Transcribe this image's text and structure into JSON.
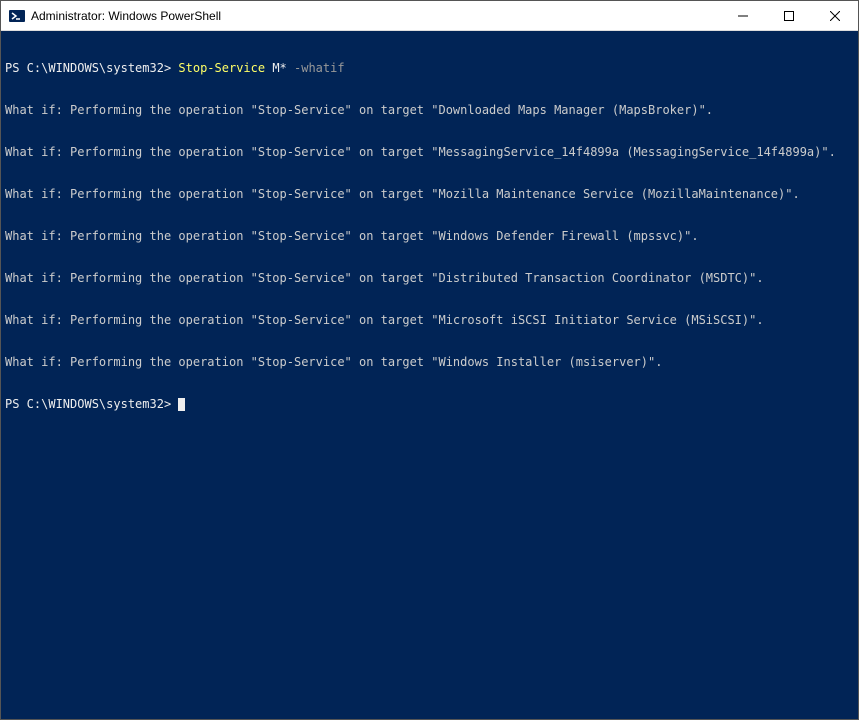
{
  "titlebar": {
    "title": "Administrator: Windows PowerShell"
  },
  "terminal": {
    "prompt1": "PS C:\\WINDOWS\\system32> ",
    "command": "Stop-Service",
    "arg": " M* ",
    "param": "-whatif",
    "output_lines": [
      "What if: Performing the operation \"Stop-Service\" on target \"Downloaded Maps Manager (MapsBroker)\".",
      "What if: Performing the operation \"Stop-Service\" on target \"MessagingService_14f4899a (MessagingService_14f4899a)\".",
      "What if: Performing the operation \"Stop-Service\" on target \"Mozilla Maintenance Service (MozillaMaintenance)\".",
      "What if: Performing the operation \"Stop-Service\" on target \"Windows Defender Firewall (mpssvc)\".",
      "What if: Performing the operation \"Stop-Service\" on target \"Distributed Transaction Coordinator (MSDTC)\".",
      "What if: Performing the operation \"Stop-Service\" on target \"Microsoft iSCSI Initiator Service (MSiSCSI)\".",
      "What if: Performing the operation \"Stop-Service\" on target \"Windows Installer (msiserver)\"."
    ],
    "prompt2": "PS C:\\WINDOWS\\system32> "
  },
  "colors": {
    "terminal_bg": "#012456",
    "terminal_fg": "#cccccc",
    "command_color": "#ffff66",
    "param_color": "#999999"
  }
}
